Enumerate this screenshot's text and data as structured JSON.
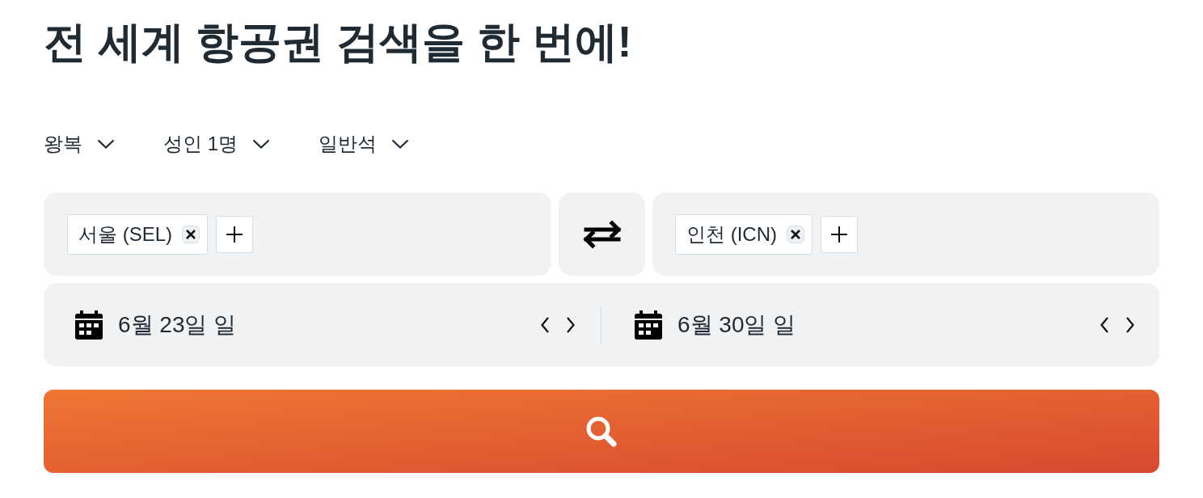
{
  "heading": "전 세계 항공권 검색을 한 번에!",
  "options": [
    {
      "label": "왕복"
    },
    {
      "label": "성인 1명"
    },
    {
      "label": "일반석"
    }
  ],
  "route": {
    "origin": {
      "chips": [
        {
          "label": "서울 (SEL)"
        }
      ]
    },
    "destination": {
      "chips": [
        {
          "label": "인천 (ICN)"
        }
      ]
    }
  },
  "dates": [
    {
      "label": "6월 23일 일"
    },
    {
      "label": "6월 30일 일"
    }
  ]
}
